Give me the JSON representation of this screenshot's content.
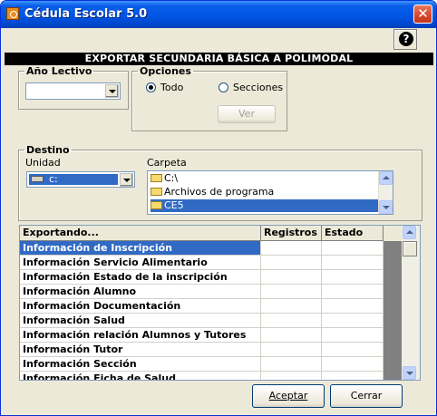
{
  "window": {
    "title": "Cédula Escolar 5.0",
    "close_label": "✕"
  },
  "help": {
    "label": "?"
  },
  "banner": "EXPORTAR SECUNDARIA BÁSICA A POLIMODAL",
  "anio_lectivo": {
    "legend": "Año Lectivo",
    "value": ""
  },
  "opciones": {
    "legend": "Opciones",
    "todo_label": "Todo",
    "secciones_label": "Secciones",
    "selected": "Todo",
    "ver_label": "Ver"
  },
  "destino": {
    "legend": "Destino",
    "unidad_label": "Unidad",
    "unidad_value": "c:",
    "carpeta_label": "Carpeta",
    "folders": [
      "C:\\",
      "Archivos de programa",
      "CE5"
    ],
    "selected_folder": "CE5"
  },
  "grid": {
    "columns": [
      "Exportando...",
      "Registros",
      "Estado"
    ],
    "rows": [
      {
        "name": "Información de Inscripción",
        "registros": "",
        "estado": ""
      },
      {
        "name": "Información Servicio Alimentario",
        "registros": "",
        "estado": ""
      },
      {
        "name": "Información Estado de la inscripción",
        "registros": "",
        "estado": ""
      },
      {
        "name": "Información Alumno",
        "registros": "",
        "estado": ""
      },
      {
        "name": "Información Documentación",
        "registros": "",
        "estado": ""
      },
      {
        "name": "Información Salud",
        "registros": "",
        "estado": ""
      },
      {
        "name": "Información relación Alumnos y Tutores",
        "registros": "",
        "estado": ""
      },
      {
        "name": "Información Tutor",
        "registros": "",
        "estado": ""
      },
      {
        "name": "Información Sección",
        "registros": "",
        "estado": ""
      },
      {
        "name": "Información Ficha de Salud",
        "registros": "",
        "estado": ""
      }
    ]
  },
  "buttons": {
    "aceptar": "Aceptar",
    "cerrar": "Cerrar"
  },
  "colors": {
    "title_bar": "#0055e5",
    "selection": "#316ac5",
    "face": "#ece9d8"
  }
}
